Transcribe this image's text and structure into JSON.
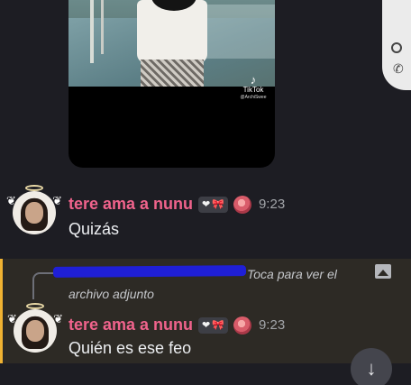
{
  "video": {
    "watermark_brand": "TikTok",
    "watermark_handle": "@ArchiSwee",
    "icon": "tiktok-logo-icon"
  },
  "call_widget": {
    "icon": "phone-icon"
  },
  "messages": [
    {
      "username": "tere ama a nunu",
      "badge_icons": [
        "heart-icon",
        "bow-icon"
      ],
      "badge_heart": "❤",
      "badge_bow": "🎀",
      "emoji_icon": "rose-icon",
      "time": "9:23",
      "text": "Quizás"
    },
    {
      "reply_preview": "Toca para ver el archivo adjunto",
      "reply_icon": "image-icon",
      "username": "tere ama a nunu",
      "badge_icons": [
        "heart-icon",
        "bow-icon"
      ],
      "badge_heart": "❤",
      "badge_bow": "🎀",
      "emoji_icon": "rose-icon",
      "time": "9:23",
      "text": "Quién es ese feo"
    }
  ],
  "scroll_button": {
    "icon": "arrow-down-icon",
    "glyph": "↓"
  },
  "colors": {
    "background": "#1d1d23",
    "username": "#f0638c",
    "highlight_bg": "#2d2a25",
    "highlight_bar": "#f0b232"
  }
}
